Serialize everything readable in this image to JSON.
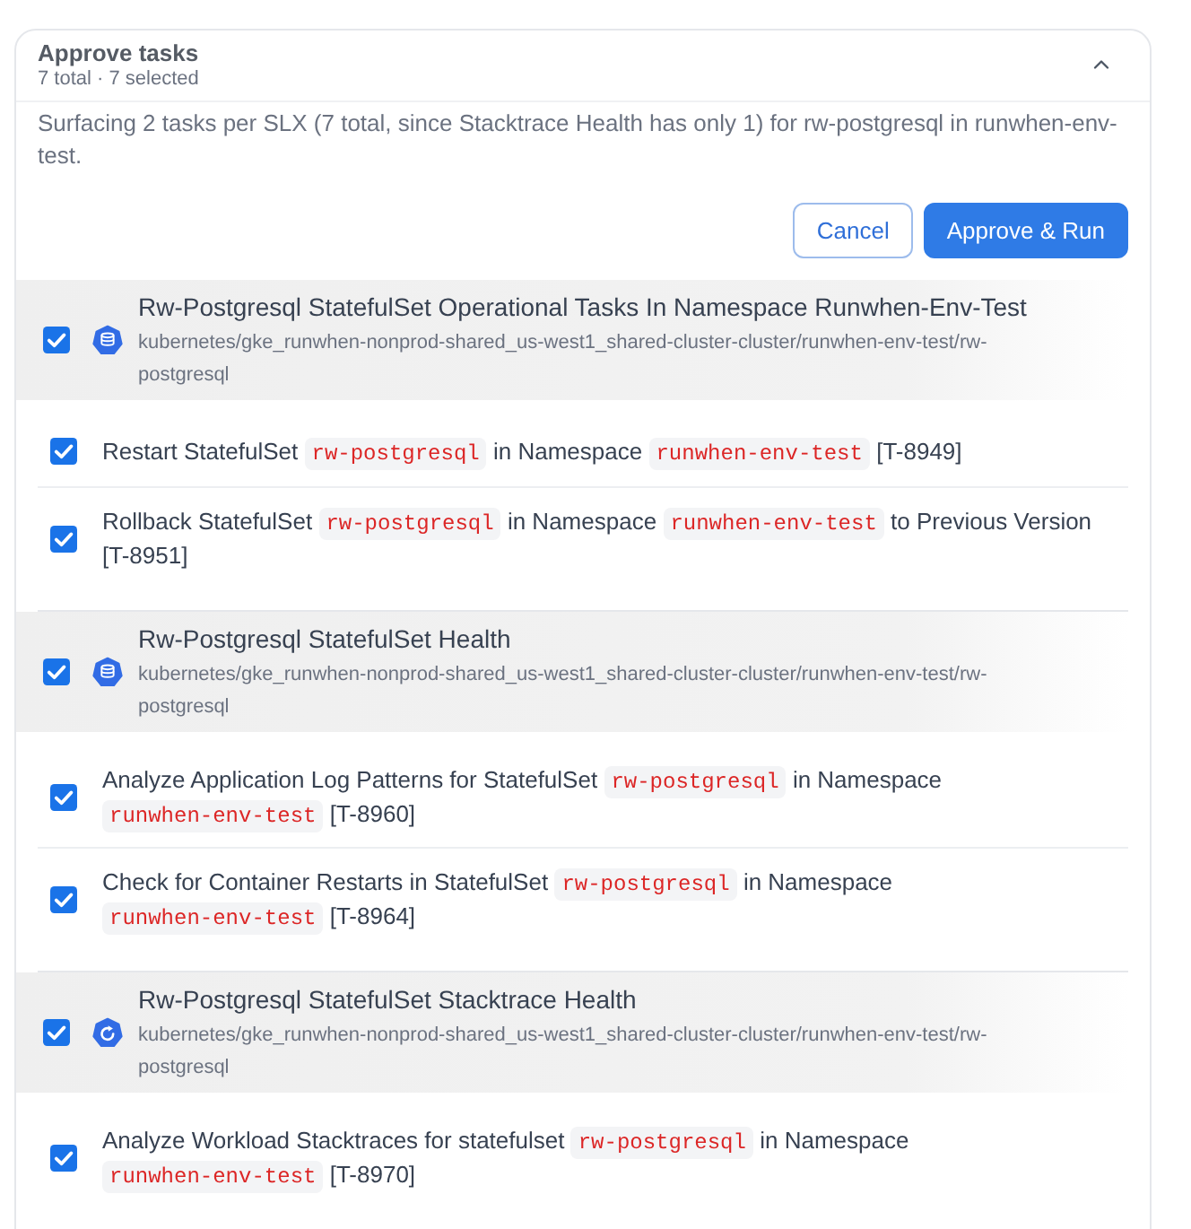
{
  "panel": {
    "title": "Approve tasks",
    "summary": "7 total · 7 selected",
    "expanded": true,
    "description": "Surfacing 2 tasks per SLX (7 total, since Stacktrace Health has only 1) for rw-postgresql in runwhen-env-test."
  },
  "buttons": [
    {
      "label": "Cancel",
      "kind": "secondary"
    },
    {
      "label": "Approve & Run",
      "kind": "primary"
    }
  ],
  "groups": [
    {
      "kind": "statefulset",
      "checked": true,
      "title": "Rw-Postgresql StatefulSet Operational Tasks In Namespace Runwhen-Env-Test",
      "path": "kubernetes/gke_runwhen-nonprod-shared_us-west1_shared-cluster-cluster/runwhen-env-test/rw-postgresql",
      "tasks": [
        {
          "checked": true,
          "parts": [
            {
              "kind": "text",
              "text": "Restart StatefulSet"
            },
            {
              "kind": "code",
              "text": "rw-postgresql"
            },
            {
              "kind": "text",
              "text": "in Namespace"
            },
            {
              "kind": "code",
              "text": "runwhen-env-test"
            }
          ],
          "id": "[T-8949]"
        },
        {
          "checked": true,
          "parts": [
            {
              "kind": "text",
              "text": "Rollback StatefulSet"
            },
            {
              "kind": "code",
              "text": "rw-postgresql"
            },
            {
              "kind": "text",
              "text": "in Namespace"
            },
            {
              "kind": "code",
              "text": "runwhen-env-test"
            },
            {
              "kind": "text",
              "text": "to Previous Version"
            }
          ],
          "id": "[T-8951]"
        }
      ]
    },
    {
      "kind": "statefulset",
      "checked": true,
      "title": "Rw-Postgresql StatefulSet Health",
      "path": "kubernetes/gke_runwhen-nonprod-shared_us-west1_shared-cluster-cluster/runwhen-env-test/rw-postgresql",
      "tasks": [
        {
          "checked": true,
          "parts": [
            {
              "kind": "text",
              "text": "Analyze Application Log Patterns for StatefulSet"
            },
            {
              "kind": "code",
              "text": "rw-postgresql"
            },
            {
              "kind": "text",
              "text": "in Namespace"
            },
            {
              "kind": "code",
              "text": "runwhen-env-test"
            }
          ],
          "id": "[T-8960]"
        },
        {
          "checked": true,
          "parts": [
            {
              "kind": "text",
              "text": "Check for Container Restarts in StatefulSet"
            },
            {
              "kind": "code",
              "text": "rw-postgresql"
            },
            {
              "kind": "text",
              "text": "in Namespace"
            },
            {
              "kind": "code",
              "text": "runwhen-env-test"
            }
          ],
          "id": "[T-8964]"
        }
      ]
    },
    {
      "kind": "stacktrace",
      "checked": true,
      "title": "Rw-Postgresql StatefulSet Stacktrace Health",
      "path": "kubernetes/gke_runwhen-nonprod-shared_us-west1_shared-cluster-cluster/runwhen-env-test/rw-postgresql",
      "tasks": [
        {
          "checked": true,
          "parts": [
            {
              "kind": "text",
              "text": "Analyze Workload Stacktraces for statefulset"
            },
            {
              "kind": "code",
              "text": "rw-postgresql"
            },
            {
              "kind": "text",
              "text": "in Namespace"
            },
            {
              "kind": "code",
              "text": "runwhen-env-test"
            }
          ],
          "id": "[T-8970]"
        }
      ]
    }
  ]
}
